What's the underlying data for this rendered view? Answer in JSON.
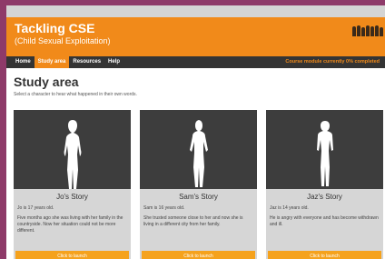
{
  "site": {
    "title": "Tackling CSE",
    "subtitle": "(Child Sexual Exploitation)"
  },
  "nav": {
    "items": [
      {
        "label": "Home",
        "active": false
      },
      {
        "label": "Study area",
        "active": true
      },
      {
        "label": "Resources",
        "active": false
      },
      {
        "label": "Help",
        "active": false
      }
    ],
    "course_status": "Course module currently 0% completed"
  },
  "main": {
    "title": "Study area",
    "instruction": "Select a character to hear what happened in their own words."
  },
  "cards": [
    {
      "name": "Jo's Story",
      "age": "Jo is 17 years old.",
      "description": "Five months ago she was living with her family in the countryside. Now her situation could not be more different.",
      "button": "Click to launch"
    },
    {
      "name": "Sam's Story",
      "age": "Sam is 16 years old.",
      "description": "She trusted someone close to her and now she is living in a different city from her family.",
      "button": "Click to launch"
    },
    {
      "name": "Jaz's Story",
      "age": "Jaz is 14 years old.",
      "description": "He is angry with everyone and has become withdrawn and ill.",
      "button": "Click to launch"
    }
  ],
  "colors": {
    "accent": "#f18a1a",
    "nav_bg": "#343434",
    "outer_bg": "#8e3a69",
    "card_bg": "#d6d6d6",
    "card_image_bg": "#3d3d3d"
  },
  "icons": {
    "logo": "people-group-logo",
    "character": "person-silhouette-icon"
  }
}
